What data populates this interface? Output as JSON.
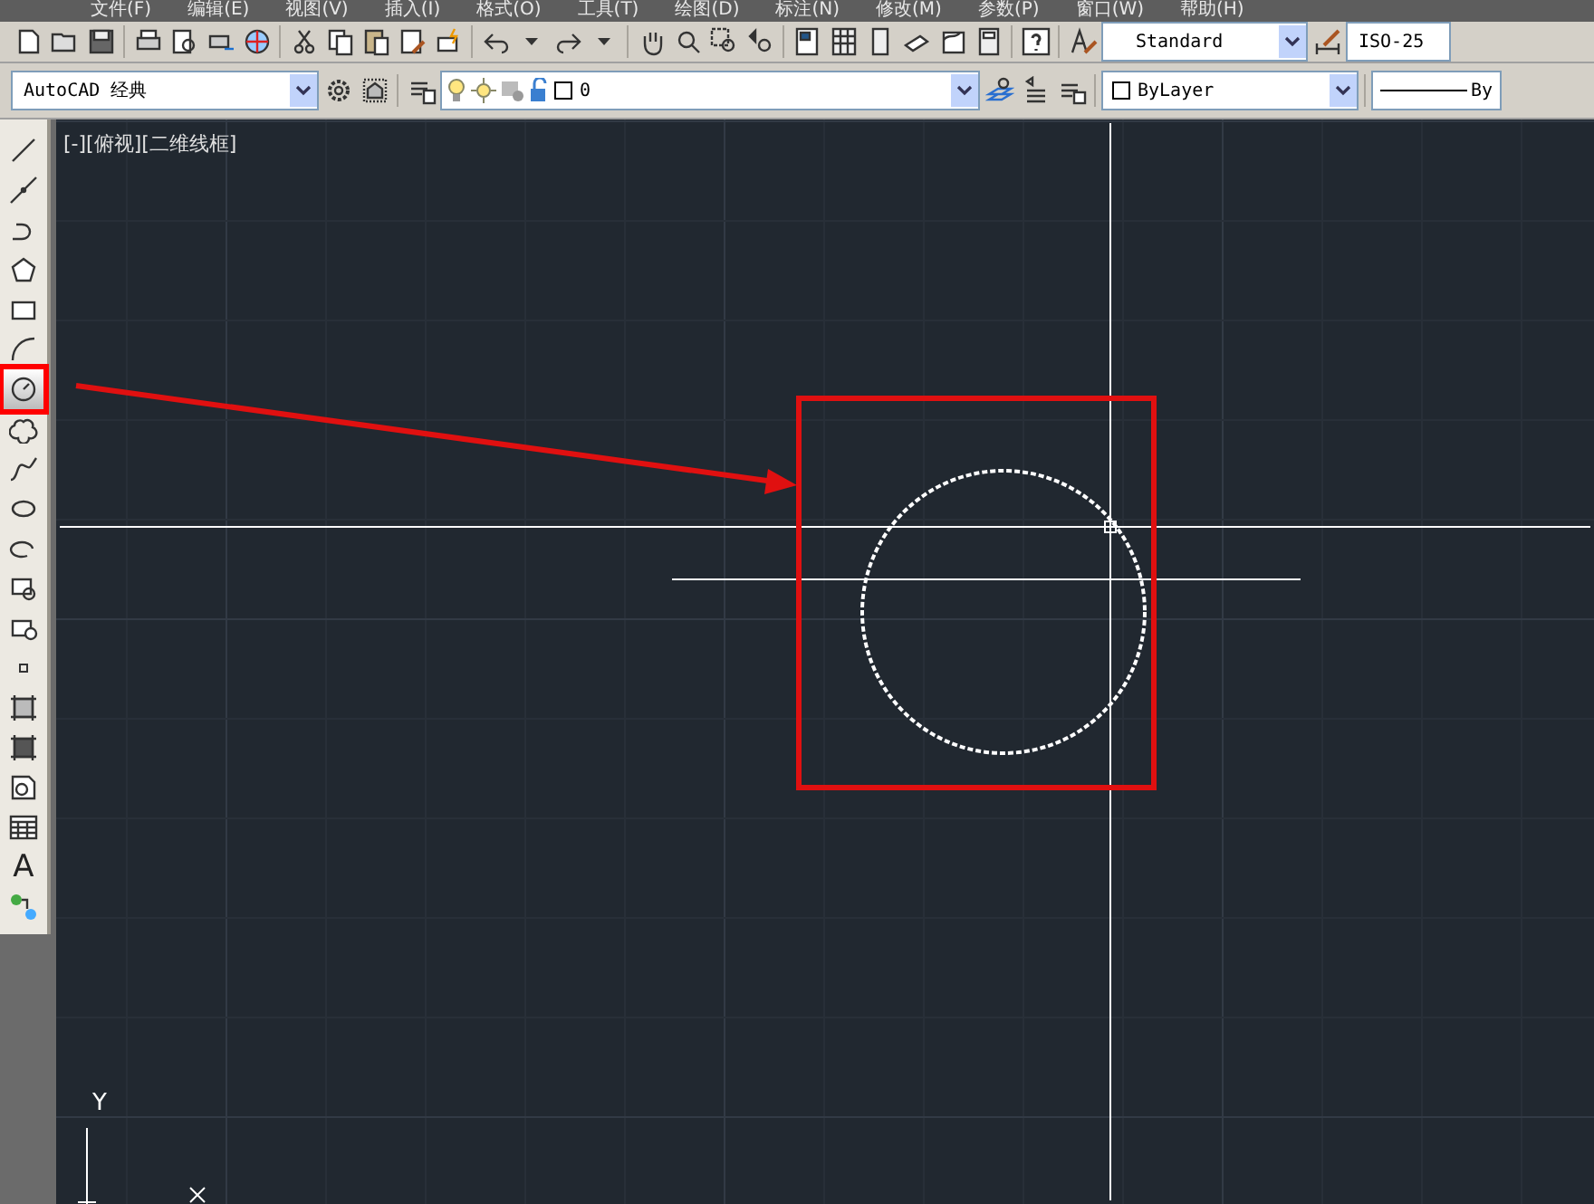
{
  "menu": [
    "文件(F)",
    "编辑(E)",
    "视图(V)",
    "插入(I)",
    "格式(O)",
    "工具(T)",
    "绘图(D)",
    "标注(N)",
    "修改(M)",
    "参数(P)",
    "窗口(W)",
    "帮助(H)"
  ],
  "styles_toolbar": {
    "text_style": "Standard",
    "dim_style": "ISO-25"
  },
  "workspace": {
    "value": "AutoCAD 经典"
  },
  "layer": {
    "value": "0"
  },
  "properties": {
    "color_setting": "ByLayer",
    "linetype": "By"
  },
  "viewport": {
    "label": "[-][俯视][二维线框]"
  },
  "draw_tools": [
    {
      "kind": "line",
      "selected": false,
      "highlighted": false
    },
    {
      "kind": "xline",
      "selected": false,
      "highlighted": false
    },
    {
      "kind": "polyline",
      "selected": false,
      "highlighted": false
    },
    {
      "kind": "polygon",
      "selected": false,
      "highlighted": false
    },
    {
      "kind": "rectangle",
      "selected": false,
      "highlighted": false
    },
    {
      "kind": "arc",
      "selected": false,
      "highlighted": false
    },
    {
      "kind": "circle",
      "selected": true,
      "highlighted": true
    },
    {
      "kind": "cloud",
      "selected": false,
      "highlighted": false
    },
    {
      "kind": "spline",
      "selected": false,
      "highlighted": false
    },
    {
      "kind": "ellipse",
      "selected": false,
      "highlighted": false
    },
    {
      "kind": "ellipse-arc",
      "selected": false,
      "highlighted": false
    },
    {
      "kind": "insert",
      "selected": false,
      "highlighted": false
    },
    {
      "kind": "block",
      "selected": false,
      "highlighted": false
    },
    {
      "kind": "point",
      "selected": false,
      "highlighted": false
    },
    {
      "kind": "hatch",
      "selected": false,
      "highlighted": false
    },
    {
      "kind": "gradient",
      "selected": false,
      "highlighted": false
    },
    {
      "kind": "region",
      "selected": false,
      "highlighted": false
    },
    {
      "kind": "table",
      "selected": false,
      "highlighted": false
    },
    {
      "kind": "text",
      "label": "A",
      "selected": false,
      "highlighted": false
    },
    {
      "kind": "add-selected",
      "selected": false,
      "highlighted": false
    }
  ],
  "ucs": {
    "y_label": "Y"
  }
}
